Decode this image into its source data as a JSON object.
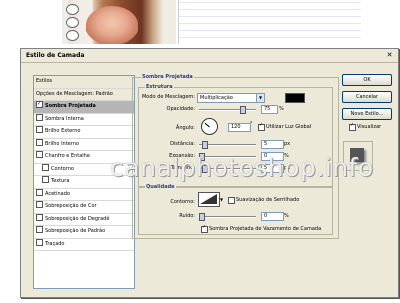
{
  "dialog": {
    "title": "Estilo de Camada"
  },
  "styles_list": {
    "header": "Estilos",
    "blend_options": "Opções de Mesclagem: Padrão",
    "items": [
      {
        "label": "Sombra Projetada",
        "checked": true,
        "selected": true
      },
      {
        "label": "Sombra Interna",
        "checked": false
      },
      {
        "label": "Brilho Externo",
        "checked": false
      },
      {
        "label": "Brilho Interno",
        "checked": false
      },
      {
        "label": "Chanfro e Entalhe",
        "checked": false
      },
      {
        "label": "Contorno",
        "checked": false,
        "indent": true
      },
      {
        "label": "Textura",
        "checked": false,
        "indent": true
      },
      {
        "label": "Acetinado",
        "checked": false
      },
      {
        "label": "Sobreposição de Cor",
        "checked": false
      },
      {
        "label": "Sobreposição de Degradê",
        "checked": false
      },
      {
        "label": "Sobreposição de Padrão",
        "checked": false
      },
      {
        "label": "Traçado",
        "checked": false
      }
    ]
  },
  "drop_shadow": {
    "section_title": "Sombra Projetada",
    "structure_title": "Estrutura",
    "blend_mode_label": "Modo de Mesclagem:",
    "blend_mode_value": "Multiplicação",
    "shadow_color": "#000000",
    "opacity_label": "Opacidade:",
    "opacity_value": "75",
    "angle_label": "Ângulo:",
    "angle_value": "120",
    "global_light_label": "Utilizar Luz Global",
    "distance_label": "Distância:",
    "distance_value": "5",
    "spread_label": "Expansão:",
    "spread_value": "0",
    "size_label": "Tamanho:",
    "size_value": "5",
    "quality_title": "Qualidade",
    "contour_label": "Contorno:",
    "antialias_label": "Suavização de Serrilhado",
    "noise_label": "Ruído:",
    "noise_value": "0",
    "knockout_label": "Sombra Projetada de Vazamento de Camada",
    "unit_percent": "%",
    "unit_px": "px",
    "unit_degree": "°"
  },
  "buttons": {
    "ok": "OK",
    "cancel": "Cancelar",
    "new_style": "Novo Estilo...",
    "preview": "Visualizar"
  },
  "watermark": "canalphotoshop.info"
}
